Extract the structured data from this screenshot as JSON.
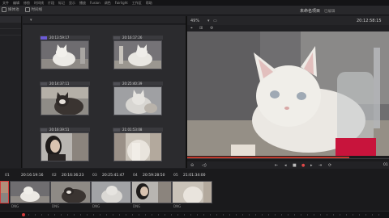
{
  "menubar": {
    "items": [
      "文件",
      "编辑",
      "修剪",
      "时间线",
      "片段",
      "标记",
      "显示",
      "播放",
      "Fusion",
      "调色",
      "Fairlight",
      "工作区",
      "帮助"
    ]
  },
  "topbar": {
    "buttons": [
      {
        "label": "媒体池",
        "icon": "media-pool-icon"
      },
      {
        "label": "时间线",
        "icon": "timeline-icon"
      }
    ],
    "project_title": "未命名项目",
    "project_status": "已编辑"
  },
  "media_pool": {
    "menu_icon": "▾",
    "clips": [
      {
        "index": "01",
        "timecode": "20:13:59:17",
        "selected": true
      },
      {
        "index": "02",
        "timecode": "20:16:17:26",
        "selected": false
      },
      {
        "index": "03",
        "timecode": "20:14:37:11",
        "selected": false
      },
      {
        "index": "04",
        "timecode": "20:25:40:39",
        "selected": false
      },
      {
        "index": "05",
        "timecode": "20:16:39:51",
        "selected": false
      },
      {
        "index": "06",
        "timecode": "21:01:53:08",
        "selected": false
      }
    ]
  },
  "viewer": {
    "zoom": "49%",
    "timecode": "20:12:58:15",
    "transport": [
      "⇤",
      "◂",
      "■",
      "▸",
      "⇥",
      "⟳"
    ],
    "record_symbol": "●",
    "volume_symbol": "◁)"
  },
  "timeline": {
    "current_timecode": "01",
    "clips": [
      {
        "index": "01",
        "timecode": "20:16:19:16",
        "label": "DNG"
      },
      {
        "index": "02",
        "timecode": "20:16:36:23",
        "label": "DNG"
      },
      {
        "index": "03",
        "timecode": "20:25:41:47",
        "label": "DNG"
      },
      {
        "index": "04",
        "timecode": "20:59:28:50",
        "label": "DNG"
      },
      {
        "index": "05",
        "timecode": "21:01:34:00",
        "label": "DNG"
      }
    ]
  },
  "colors": {
    "accent_selected": "#6c5bd6",
    "playhead": "#d23a3a",
    "record": "#e04848"
  }
}
